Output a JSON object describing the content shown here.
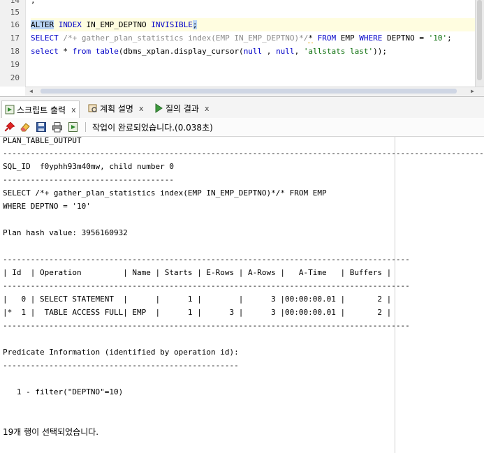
{
  "editor": {
    "line_numbers": [
      "14",
      "15",
      "16",
      "17",
      "18",
      "19",
      "20"
    ],
    "top_fragment": ";",
    "line16": {
      "kw1": "ALTER",
      "kw2": "INDEX",
      "ident": "IN_EMP_DEPTNO",
      "kw3": "INVISIBLE",
      "end": ";"
    },
    "line17": {
      "kw_select": "SELECT",
      "hint": "/*+ gather_plan_statistics index(EMP IN_EMP_DEPTNO)*/",
      "star": "*",
      "kw_from": "FROM",
      "table": "EMP",
      "kw_where": "WHERE",
      "cond": "DEPTNO =",
      "value": "'10'",
      "end": ";"
    },
    "line18": {
      "kw_select": "select",
      "star": "*",
      "kw_from": "from",
      "kw_table": "table",
      "func": "(dbms_xplan.display_cursor(",
      "null1": "null",
      "comma1": " , ",
      "null2": "null",
      "comma2": ", ",
      "str": "'allstats last'",
      "end": "));"
    }
  },
  "tabs": [
    {
      "label": "스크립트 출력",
      "close": "x"
    },
    {
      "label": "계획 설명",
      "close": "x"
    },
    {
      "label": "질의 결과",
      "close": "x"
    }
  ],
  "toolbar": {
    "buttons": [
      "pin-icon",
      "eraser-icon",
      "save-icon",
      "print-icon",
      "export-icon"
    ],
    "status": "작업이 완료되었습니다.(0.038초)"
  },
  "output": {
    "lines": [
      "PLAN_TABLE_OUTPUT",
      "------------------------------------------------------------------------------------------------------------",
      "SQL_ID  f0yphh93m40mw, child number 0",
      "-------------------------------------",
      "SELECT /*+ gather_plan_statistics index(EMP IN_EMP_DEPTNO)*/* FROM EMP",
      "WHERE DEPTNO = '10'",
      "",
      "Plan hash value: 3956160932",
      "",
      "----------------------------------------------------------------------------------------",
      "| Id  | Operation         | Name | Starts | E-Rows | A-Rows |   A-Time   | Buffers |",
      "----------------------------------------------------------------------------------------",
      "|   0 | SELECT STATEMENT  |      |      1 |        |      3 |00:00:00.01 |       2 |",
      "|*  1 |  TABLE ACCESS FULL| EMP  |      1 |      3 |      3 |00:00:00.01 |       2 |",
      "----------------------------------------------------------------------------------------",
      "",
      "Predicate Information (identified by operation id):",
      "---------------------------------------------------",
      "",
      "   1 - filter(\"DEPTNO\"=10)",
      "",
      ""
    ],
    "footer": "19개 행이 선택되었습니다."
  }
}
